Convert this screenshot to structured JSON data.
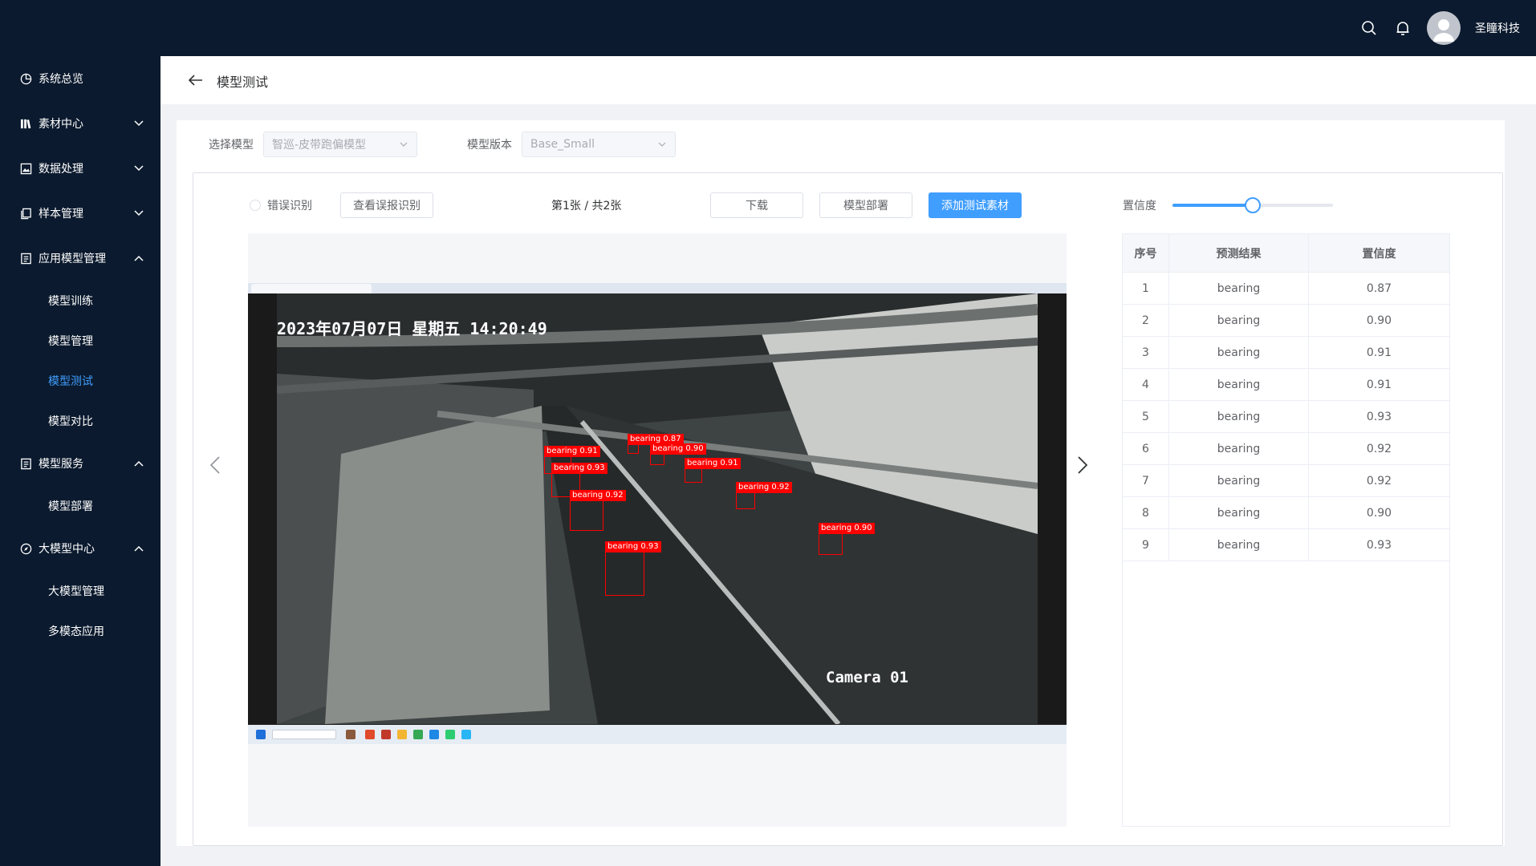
{
  "header": {
    "username": "圣瞳科技",
    "icons": [
      "search-icon",
      "bell-icon",
      "user-avatar-icon"
    ]
  },
  "sidebar": {
    "items": [
      {
        "label": "系统总览",
        "icon": "pie-chart-icon",
        "expandable": false
      },
      {
        "label": "素材中心",
        "icon": "library-icon",
        "expandable": true,
        "expanded": false
      },
      {
        "label": "数据处理",
        "icon": "image-icon",
        "expandable": true,
        "expanded": false
      },
      {
        "label": "样本管理",
        "icon": "copy-icon",
        "expandable": true,
        "expanded": false
      },
      {
        "label": "应用模型管理",
        "icon": "document-icon",
        "expandable": true,
        "expanded": true,
        "children": [
          {
            "label": "模型训练",
            "active": false
          },
          {
            "label": "模型管理",
            "active": false
          },
          {
            "label": "模型测试",
            "active": true
          },
          {
            "label": "模型对比",
            "active": false
          }
        ]
      },
      {
        "label": "模型服务",
        "icon": "document-icon",
        "expandable": true,
        "expanded": true,
        "children": [
          {
            "label": "模型部署",
            "active": false
          }
        ]
      },
      {
        "label": "大模型中心",
        "icon": "compass-icon",
        "expandable": true,
        "expanded": true,
        "children": [
          {
            "label": "大模型管理",
            "active": false
          },
          {
            "label": "多模态应用",
            "active": false
          }
        ]
      }
    ],
    "active_color": "#409eff"
  },
  "page": {
    "title": "模型测试"
  },
  "filters": {
    "model_label": "选择模型",
    "model_value": "智巡-皮带跑偏模型",
    "version_label": "模型版本",
    "version_value": "Base_Small"
  },
  "toolbar": {
    "radio_label": "错误识别",
    "view_errors_label": "查看误报识别",
    "page_info": "第1张 / 共2张",
    "download_label": "下载",
    "deploy_label": "模型部署",
    "add_material_label": "添加测试素材",
    "confidence_label": "置信度",
    "confidence_value": 0.5
  },
  "image": {
    "timestamp": "2023年07月07日 星期五 14:20:49",
    "camera": "Camera 01",
    "detections": [
      {
        "label": "bearing 0.91"
      },
      {
        "label": "bearing 0.93"
      },
      {
        "label": "bearing 0.92"
      },
      {
        "label": "bearing 0.93"
      },
      {
        "label": "bearing 0.87"
      },
      {
        "label": "bearing 0.90"
      },
      {
        "label": "bearing 0.91"
      },
      {
        "label": "bearing 0.92"
      },
      {
        "label": "bearing 0.90"
      }
    ]
  },
  "results_table": {
    "columns": [
      "序号",
      "预测结果",
      "置信度"
    ],
    "rows": [
      [
        "1",
        "bearing",
        "0.87"
      ],
      [
        "2",
        "bearing",
        "0.90"
      ],
      [
        "3",
        "bearing",
        "0.91"
      ],
      [
        "4",
        "bearing",
        "0.91"
      ],
      [
        "5",
        "bearing",
        "0.93"
      ],
      [
        "6",
        "bearing",
        "0.92"
      ],
      [
        "7",
        "bearing",
        "0.92"
      ],
      [
        "8",
        "bearing",
        "0.90"
      ],
      [
        "9",
        "bearing",
        "0.93"
      ]
    ]
  },
  "colors": {
    "sidebar_bg": "#0b1a2e",
    "primary": "#409eff",
    "detection": "#ff0000"
  }
}
